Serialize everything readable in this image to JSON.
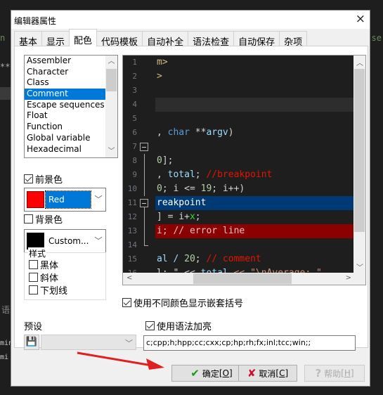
{
  "background": {
    "left_fragments": [
      "n",
      "**"
    ],
    "right_fragments": [
      "se"
    ],
    "bottom_left_fragments": [
      "语",
      "min",
      "mi"
    ]
  },
  "dialog": {
    "title": "编辑器属性",
    "close_label": "×",
    "tabs": [
      {
        "label": "基本",
        "active": false
      },
      {
        "label": "显示",
        "active": false
      },
      {
        "label": "配色",
        "active": true
      },
      {
        "label": "代码模板",
        "active": false
      },
      {
        "label": "自动补全",
        "active": false
      },
      {
        "label": "语法检查",
        "active": false
      },
      {
        "label": "自动保存",
        "active": false
      },
      {
        "label": "杂项",
        "active": false
      }
    ]
  },
  "elements_list": {
    "items": [
      "Assembler",
      "Character",
      "Class",
      "Comment",
      "Escape sequences",
      "Float",
      "Function",
      "Global variable",
      "Hexadecimal"
    ],
    "selected": "Comment"
  },
  "foreground": {
    "label": "前景色",
    "checked": true,
    "color_name": "Red",
    "color_hex": "#ff0000"
  },
  "background_color": {
    "label": "背景色",
    "checked": false,
    "color_name": "Custom...",
    "color_hex": "#000000"
  },
  "style": {
    "label": "样式",
    "options": [
      {
        "label": "黑体",
        "checked": false
      },
      {
        "label": "斜体",
        "checked": false
      },
      {
        "label": "下划线",
        "checked": false
      }
    ]
  },
  "preview": {
    "lines": [
      {
        "num": "1",
        "segments": [
          {
            "t": "m>",
            "c": "#d7ba7d"
          }
        ]
      },
      {
        "num": "2",
        "segments": [
          {
            "t": ">",
            "c": "#d7ba7d"
          }
        ]
      },
      {
        "num": "3",
        "segments": []
      },
      {
        "num": "4",
        "segments": [],
        "bg": "#2d2d2d"
      },
      {
        "num": "5",
        "segments": []
      },
      {
        "num": "6",
        "segments": [
          {
            "t": ", ",
            "c": "#d4d4d4"
          },
          {
            "t": "char",
            "c": "#569cd6"
          },
          {
            "t": " **",
            "c": "#d4d4d4"
          },
          {
            "t": "argv",
            "c": "#9cdcfe"
          },
          {
            "t": ")",
            "c": "#d4d4d4"
          }
        ]
      },
      {
        "num": "7",
        "segments": [],
        "fold": true
      },
      {
        "num": "8",
        "segments": [
          {
            "t": "0",
            "c": "#b5cea8"
          },
          {
            "t": "];",
            "c": "#d4d4d4"
          }
        ]
      },
      {
        "num": "9",
        "segments": [
          {
            "t": ", ",
            "c": "#d4d4d4"
          },
          {
            "t": "total",
            "c": "#9cdcfe"
          },
          {
            "t": "; ",
            "c": "#d4d4d4"
          },
          {
            "t": "//breakpoint",
            "c": "#e51400"
          }
        ]
      },
      {
        "num": "10",
        "segments": [
          {
            "t": "0",
            "c": "#b5cea8"
          },
          {
            "t": "; i <= ",
            "c": "#d4d4d4"
          },
          {
            "t": "19",
            "c": "#b5cea8"
          },
          {
            "t": "; i++)",
            "c": "#d4d4d4"
          }
        ]
      },
      {
        "num": "11",
        "segments": [
          {
            "t": "reakpoint",
            "c": "#ffffff"
          }
        ],
        "bg": "#003a75",
        "fold": true
      },
      {
        "num": "12",
        "segments": [
          {
            "t": "] = i+",
            "c": "#d4d4d4"
          },
          {
            "t": "x",
            "c": "#2fdc3a"
          },
          {
            "t": ";",
            "c": "#d4d4d4"
          }
        ]
      },
      {
        "num": "13",
        "segments": [
          {
            "t": "i; // error line",
            "c": "#f0c0c0"
          }
        ],
        "bg": "#8b0000"
      },
      {
        "num": "14",
        "segments": [],
        "foldend": true
      },
      {
        "num": "15",
        "segments": [
          {
            "t": "al / ",
            "c": "#9cdcfe"
          },
          {
            "t": "20",
            "c": "#b5cea8"
          },
          {
            "t": "; ",
            "c": "#d4d4d4"
          },
          {
            "t": "// comment",
            "c": "#e51400"
          }
        ]
      },
      {
        "num": "16",
        "segments": [
          {
            "t": "l: \" << ",
            "c": "#d4d4d4"
          },
          {
            "t": "total",
            "c": "#9cdcfe"
          },
          {
            "t": " << \"\\nAverage: \"",
            "c": "#ce9178"
          }
        ]
      }
    ]
  },
  "options": {
    "rainbow_brackets": {
      "label": "使用不同颜色显示嵌套括号",
      "checked": true
    },
    "syntax_highlight": {
      "label": "使用语法加亮",
      "checked": true
    }
  },
  "preset": {
    "label": "预设",
    "value": "",
    "extensions": "c;cpp;h;hpp;cc;cxx;cp;hp;rh;fx;inl;tcc;win;;"
  },
  "buttons": {
    "ok": {
      "label": "确定",
      "key": "O"
    },
    "cancel": {
      "label": "取消",
      "key": "C"
    },
    "help": {
      "label": "帮助",
      "key": "H"
    }
  }
}
